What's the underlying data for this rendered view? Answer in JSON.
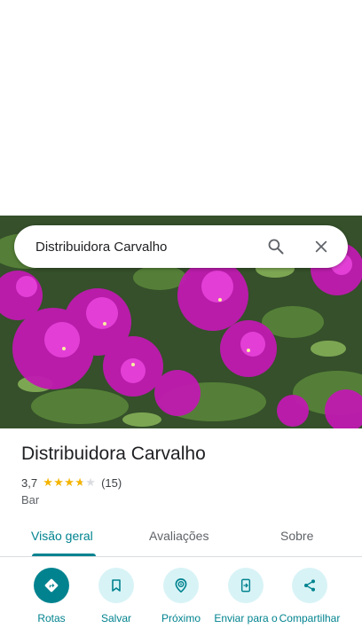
{
  "search": {
    "query": "Distribuidora Carvalho"
  },
  "place": {
    "title": "Distribuidora Carvalho",
    "rating": "3,7",
    "stars_filled_fraction": 0.74,
    "review_count": "(15)",
    "category": "Bar"
  },
  "tabs": [
    {
      "label": "Visão geral",
      "active": true
    },
    {
      "label": "Avaliações",
      "active": false
    },
    {
      "label": "Sobre",
      "active": false
    }
  ],
  "actions": [
    {
      "label": "Rotas",
      "icon": "directions-icon"
    },
    {
      "label": "Salvar",
      "icon": "bookmark-icon"
    },
    {
      "label": "Próximo",
      "icon": "nearby-icon"
    },
    {
      "label": "Enviar para o",
      "icon": "send-to-phone-icon"
    },
    {
      "label": "Compartilhar",
      "icon": "share-icon"
    }
  ],
  "colors": {
    "accent": "#00838f",
    "action_bg": "#d8f3f6",
    "star": "#f4b400",
    "star_empty": "#dadce0",
    "text_primary": "#202124",
    "text_secondary": "#5f6368"
  }
}
